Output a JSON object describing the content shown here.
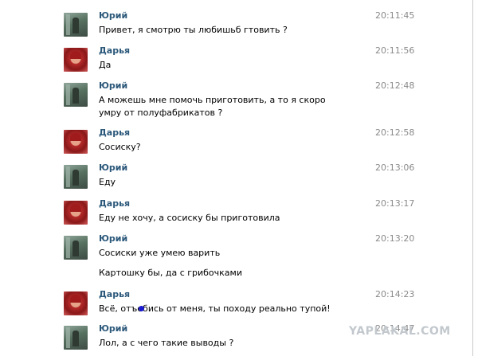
{
  "messages": [
    {
      "author": "Юрий",
      "time": "20:11:45",
      "text": "Привет, я смотрю ты любишьб гтовить ?"
    },
    {
      "author": "Дарья",
      "time": "20:11:56",
      "text": "Да"
    },
    {
      "author": "Юрий",
      "time": "20:12:48",
      "text": "А можешь мне помочь приготовить, а то я скоро умру от полуфабрикатов ?"
    },
    {
      "author": "Дарья",
      "time": "20:12:58",
      "text": "Сосиску?"
    },
    {
      "author": "Юрий",
      "time": "20:13:06",
      "text": "Еду"
    },
    {
      "author": "Дарья",
      "time": "20:13:17",
      "text": "Еду не хочу, а сосиску бы приготовила"
    },
    {
      "author": "Юрий",
      "time": "20:13:20",
      "text": "Сосиски уже умею варить"
    },
    {
      "author": "Дарья",
      "time": "20:14:23",
      "text": "Всё, отъебись от меня, ты походу реально тупой!"
    },
    {
      "author": "Юрий",
      "time": "20:14:47",
      "text": "Лол, а с чего такие выводы ?"
    }
  ],
  "extra_text": "Картошку бы, да с грибочками",
  "watermark": "YAPLAKAL.COM"
}
